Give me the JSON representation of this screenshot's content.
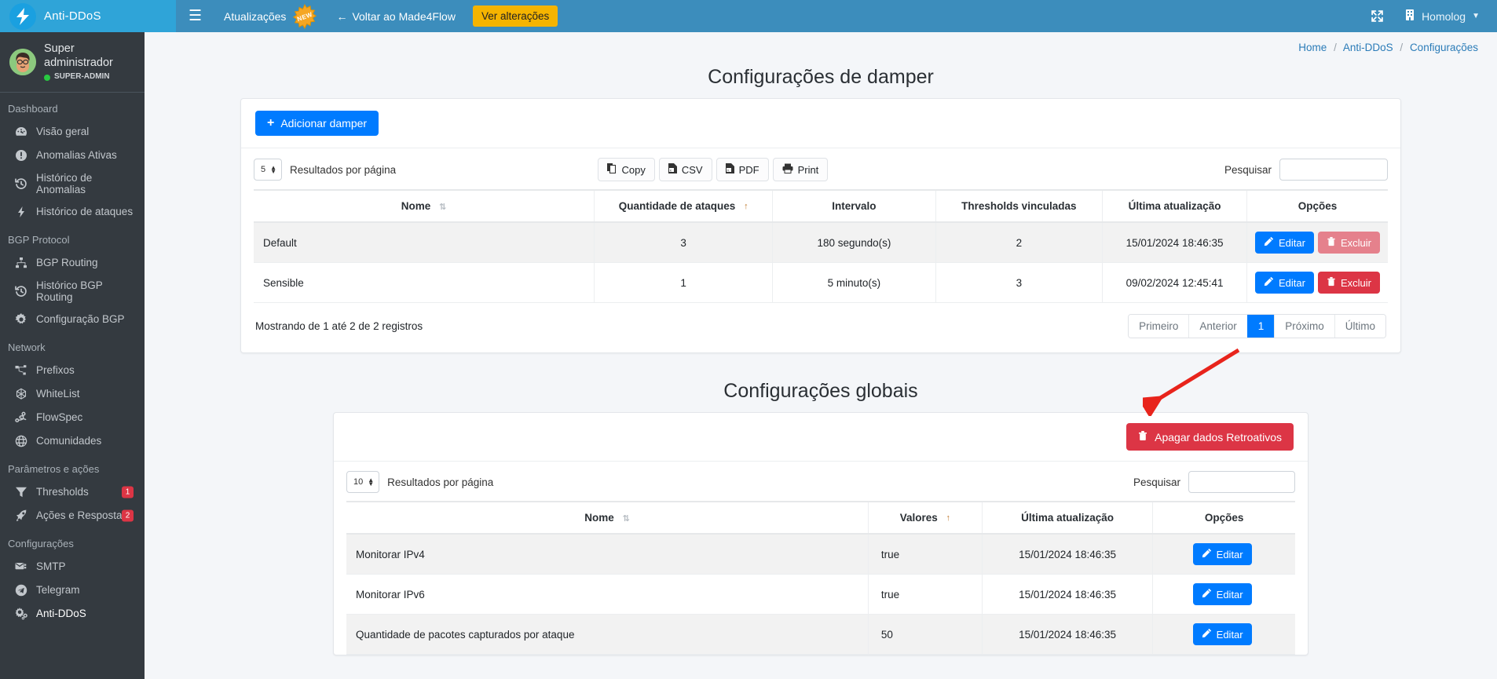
{
  "topbar": {
    "brand": "Anti-DDoS",
    "hamburger_icon": "hamburger-icon",
    "updates_label": "Atualizações",
    "new_badge": "NEW",
    "back_label": "Voltar ao Made4Flow",
    "changes_button": "Ver alterações",
    "fullscreen_icon": "expand-icon",
    "tenant_label": "Homolog",
    "accent": "#3c8dbc",
    "brand_bg": "#2fa4d8",
    "warning": "#f5b400"
  },
  "sidebar": {
    "user": {
      "name": "Super administrador",
      "role": "SUPER-ADMIN",
      "status_color": "#28c941"
    },
    "groups": [
      {
        "title": "Dashboard",
        "items": [
          {
            "label": "Visão geral",
            "icon": "gauge-icon",
            "badge": ""
          },
          {
            "label": "Anomalias Ativas",
            "icon": "exclamation-circle-icon",
            "badge": ""
          },
          {
            "label": "Histórico de Anomalias",
            "icon": "history-icon",
            "badge": ""
          },
          {
            "label": "Histórico de ataques",
            "icon": "bolt-icon",
            "badge": ""
          }
        ]
      },
      {
        "title": "BGP Protocol",
        "items": [
          {
            "label": "BGP Routing",
            "icon": "sitemap-icon",
            "badge": ""
          },
          {
            "label": "Histórico BGP Routing",
            "icon": "history-icon",
            "badge": ""
          },
          {
            "label": "Configuração BGP",
            "icon": "gear-icon",
            "badge": ""
          }
        ]
      },
      {
        "title": "Network",
        "items": [
          {
            "label": "Prefixos",
            "icon": "network-icon",
            "badge": ""
          },
          {
            "label": "WhiteList",
            "icon": "hexagon-icon",
            "badge": ""
          },
          {
            "label": "FlowSpec",
            "icon": "route-icon",
            "badge": ""
          },
          {
            "label": "Comunidades",
            "icon": "globe-icon",
            "badge": ""
          }
        ]
      },
      {
        "title": "Parâmetros e ações",
        "items": [
          {
            "label": "Thresholds",
            "icon": "filter-icon",
            "badge": "1"
          },
          {
            "label": "Ações e Respostas",
            "icon": "rocket-icon",
            "badge": "2"
          }
        ]
      },
      {
        "title": "Configurações",
        "items": [
          {
            "label": "SMTP",
            "icon": "mail-stack-icon",
            "badge": ""
          },
          {
            "label": "Telegram",
            "icon": "telegram-icon",
            "badge": ""
          },
          {
            "label": "Anti-DDoS",
            "icon": "gears-icon",
            "badge": "",
            "active": true
          }
        ]
      }
    ]
  },
  "breadcrumb": {
    "items": [
      "Home",
      "Anti-DDoS",
      "Configurações"
    ],
    "separator": "/"
  },
  "damper": {
    "title": "Configurações de damper",
    "add_button": "Adicionar damper",
    "page_length": "5",
    "page_length_label": "Resultados por página",
    "export_buttons": [
      {
        "label": "Copy",
        "icon": "copy-icon"
      },
      {
        "label": "CSV",
        "icon": "file-csv-icon"
      },
      {
        "label": "PDF",
        "icon": "file-pdf-icon"
      },
      {
        "label": "Print",
        "icon": "printer-icon"
      }
    ],
    "search_label": "Pesquisar",
    "search_value": "",
    "search_placeholder": "",
    "columns": [
      "Nome",
      "Quantidade de ataques",
      "Intervalo",
      "Thresholds vinculadas",
      "Última atualização",
      "Opções"
    ],
    "sorted_column": "Quantidade de ataques",
    "rows": [
      {
        "nome": "Default",
        "quantidade": "3",
        "intervalo": "180 segundo(s)",
        "thresholds": "2",
        "atualizacao": "15/01/2024 18:46:35",
        "edit_label": "Editar",
        "delete_label": "Excluir",
        "delete_disabled": true
      },
      {
        "nome": "Sensible",
        "quantidade": "1",
        "intervalo": "5 minuto(s)",
        "thresholds": "3",
        "atualizacao": "09/02/2024 12:45:41",
        "edit_label": "Editar",
        "delete_label": "Excluir",
        "delete_disabled": false
      }
    ],
    "showing": "Mostrando de 1 até 2 de 2 registros",
    "pager": {
      "first": "Primeiro",
      "previous": "Anterior",
      "current": "1",
      "next": "Próximo",
      "last": "Último"
    }
  },
  "globals": {
    "title": "Configurações globais",
    "purge_button": "Apagar dados Retroativos",
    "page_length": "10",
    "page_length_label": "Resultados por página",
    "search_label": "Pesquisar",
    "search_value": "",
    "search_placeholder": "",
    "columns": [
      "Nome",
      "Valores",
      "Última atualização",
      "Opções"
    ],
    "sorted_column": "Valores",
    "rows": [
      {
        "nome": "Monitorar IPv4",
        "valor": "true",
        "atualizacao": "15/01/2024 18:46:35",
        "edit_label": "Editar"
      },
      {
        "nome": "Monitorar IPv6",
        "valor": "true",
        "atualizacao": "15/01/2024 18:46:35",
        "edit_label": "Editar"
      },
      {
        "nome": "Quantidade de pacotes capturados por ataque",
        "valor": "50",
        "atualizacao": "15/01/2024 18:46:35",
        "edit_label": "Editar"
      }
    ]
  },
  "annotation": {
    "type": "arrow",
    "color": "#e8241c",
    "points_to": "Apagar dados Retroativos"
  }
}
